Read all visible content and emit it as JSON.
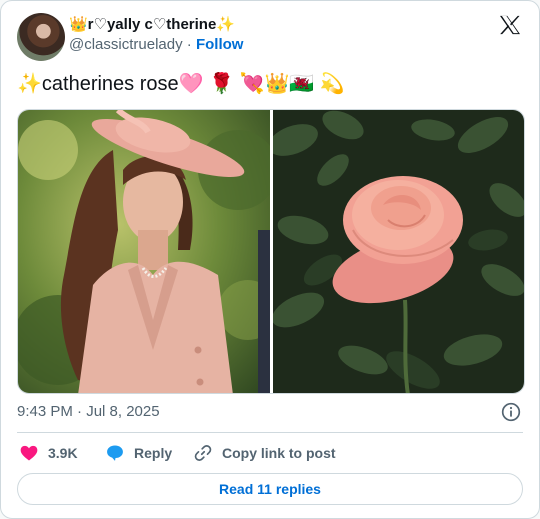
{
  "author": {
    "display_name": "👑r♡yally c♡therine✨",
    "handle": "@classictruelady",
    "separator": "·",
    "follow_label": "Follow"
  },
  "tweet": {
    "text": "✨catherines rose🩷 🌹 💘👑🏴󠁧󠁢󠁷󠁬󠁳󠁿 💫",
    "timestamp": "9:43 PM · Jul 8, 2025"
  },
  "media": {
    "left_image": "woman-in-pink-hat",
    "right_image": "pink-rose"
  },
  "actions": {
    "likes": "3.9K",
    "reply_label": "Reply",
    "copy_label": "Copy link to post"
  },
  "read_replies_label": "Read 11 replies",
  "colors": {
    "accent": "#006fd6",
    "like": "#f91880",
    "muted": "#536471"
  }
}
